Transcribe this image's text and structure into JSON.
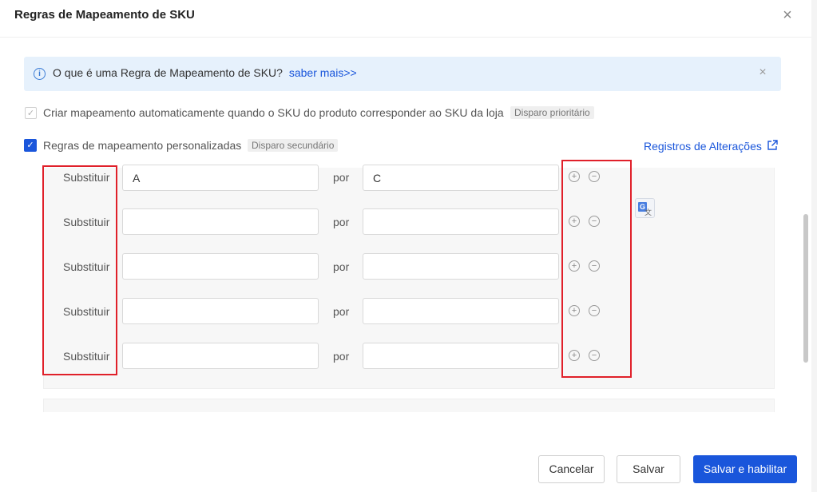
{
  "dialog": {
    "title": "Regras de Mapeamento de SKU",
    "close_icon": "close-icon"
  },
  "info": {
    "text": "O que é uma Regra de Mapeamento de SKU?",
    "link": "saber mais>>"
  },
  "option_auto": {
    "label": "Criar mapeamento automaticamente quando o SKU do produto corresponder ao SKU da loja",
    "tag": "Disparo prioritário",
    "checked": true,
    "disabled": true
  },
  "option_custom": {
    "label": "Regras de mapeamento personalizadas",
    "tag": "Disparo secundário",
    "checked": true
  },
  "change_log_link": "Registros de Alterações",
  "rules": [
    {
      "replace_label": "Substituir",
      "from_value": "A",
      "by_label": "por",
      "to_value": "C"
    },
    {
      "replace_label": "Substituir",
      "from_value": "",
      "by_label": "por",
      "to_value": ""
    },
    {
      "replace_label": "Substituir",
      "from_value": "",
      "by_label": "por",
      "to_value": ""
    },
    {
      "replace_label": "Substituir",
      "from_value": "",
      "by_label": "por",
      "to_value": ""
    },
    {
      "replace_label": "Substituir",
      "from_value": "",
      "by_label": "por",
      "to_value": ""
    }
  ],
  "footer": {
    "cancel": "Cancelar",
    "save": "Salvar",
    "save_enable": "Salvar e habilitar"
  },
  "colors": {
    "primary": "#1a56db",
    "info_bg": "#e6f1fc",
    "highlight_box": "#e0202a"
  }
}
